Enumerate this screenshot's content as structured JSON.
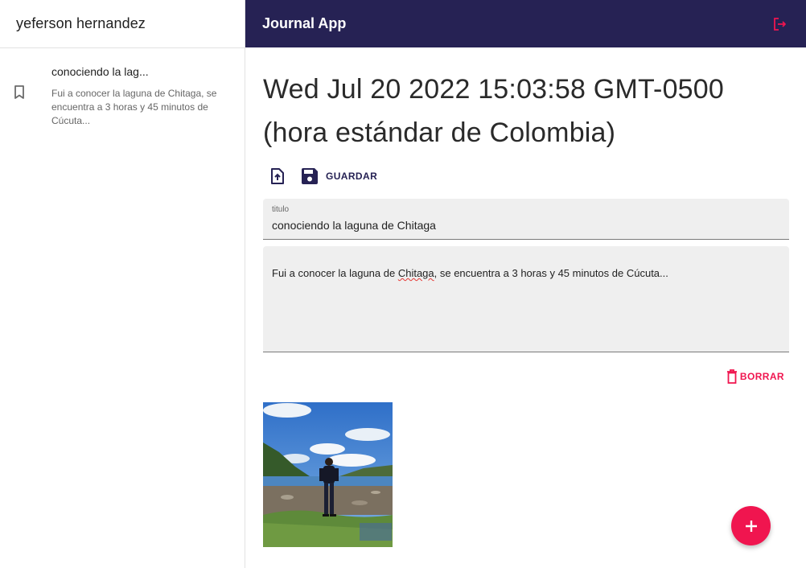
{
  "sidebar": {
    "user_name": "yeferson hernandez",
    "entries": [
      {
        "title": "conociendo la lag...",
        "body": "Fui a conocer la laguna de Chitaga, se encuentra a 3 horas y 45 minutos de Cúcuta...",
        "icon": "bookmark-outline-icon"
      }
    ]
  },
  "appbar": {
    "title": "Journal App",
    "logout_icon": "logout-icon"
  },
  "note": {
    "date": "Wed Jul 20 2022 15:03:58 GMT-0500 (hora estándar de Colombia)",
    "upload_icon": "upload-file-icon",
    "save_label": "GUARDAR",
    "title_label": "titulo",
    "title_value": "conociendo la laguna de Chitaga",
    "body_prefix": "Fui a conocer la laguna de ",
    "body_misspelled": "Chitaga",
    "body_suffix": ", se encuentra a  3 horas y 45 minutos de Cúcuta...",
    "delete_label": "BORRAR"
  },
  "gallery": {
    "images": [
      {
        "alt": "person standing by a lagoon with mountains and clouds"
      }
    ]
  },
  "fab": {
    "icon": "plus-icon"
  },
  "colors": {
    "primary": "#262254",
    "accent": "#f0154f",
    "field_bg": "#efefef"
  }
}
